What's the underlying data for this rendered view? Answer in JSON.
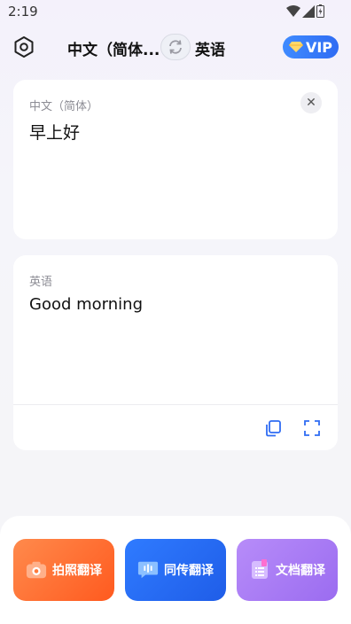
{
  "status_bar": {
    "time": "2:19"
  },
  "header": {
    "source_language": "中文（简体...",
    "target_language": "英语",
    "vip_label": "VIP"
  },
  "source_card": {
    "language_label": "中文（简体）",
    "text": "早上好"
  },
  "result_card": {
    "language_label": "英语",
    "text": "Good morning"
  },
  "features": [
    {
      "label": "拍照翻译"
    },
    {
      "label": "同传翻译"
    },
    {
      "label": "文档翻译"
    }
  ],
  "colors": {
    "accent": "#2f6cf3",
    "photo": "#ff6a2c",
    "simultaneous": "#2570f5",
    "document": "#a97af4"
  }
}
